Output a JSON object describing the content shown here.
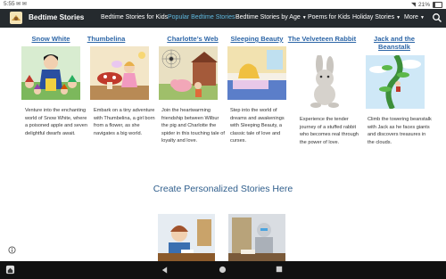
{
  "status_bar": {
    "time": "5:55",
    "notification": "✉ ✉",
    "battery_text": "21%"
  },
  "header": {
    "brand": "Bedtime Stories",
    "nav": [
      {
        "label": "Bedtime Stories for Kids",
        "active": false,
        "dropdown": false
      },
      {
        "label": "Popular Bedtime Stories",
        "active": true,
        "dropdown": false
      },
      {
        "label": "Bedtime Stories by Age",
        "active": false,
        "dropdown": true
      },
      {
        "label": "Poems for Kids",
        "active": false,
        "dropdown": false
      },
      {
        "label": "Holiday Stories",
        "active": false,
        "dropdown": true
      },
      {
        "label": "More",
        "active": false,
        "dropdown": true
      }
    ]
  },
  "stories": [
    {
      "title": "Snow White",
      "desc": "Venture into the enchanting world of Snow White, where a poisoned apple and seven delightful dwarfs await."
    },
    {
      "title": "Thumbelina",
      "desc": "Embark on a tiny adventure with Thumbelina, a girl born from a flower, as she navigates a big world."
    },
    {
      "title": "Charlotte’s Web",
      "desc": "Join the heartwarming friendship between Wilbur the pig and Charlotte the spider in this touching tale of loyalty and love."
    },
    {
      "title": "Sleeping Beauty",
      "desc": "Step into the world of dreams and awakenings with Sleeping Beauty, a classic tale of love and curses."
    },
    {
      "title": "The Velveteen Rabbit",
      "desc": "Experience the tender journey of a stuffed rabbit who becomes real through the power of love."
    },
    {
      "title": "Jack and the Beanstalk",
      "desc": "Climb the towering beanstalk with Jack as he faces giants and discovers treasures in the clouds."
    }
  ],
  "section": {
    "heading": "Create Personalized Stories Here"
  },
  "colors": {
    "navbar_bg": "#252a2e",
    "active_nav": "#5fb8de",
    "story_title": "#2d66a7",
    "heading": "#2f5e8c"
  },
  "icons": [
    "logo-icon",
    "search-icon",
    "info-icon",
    "back-icon",
    "home-icon",
    "recents-icon"
  ]
}
